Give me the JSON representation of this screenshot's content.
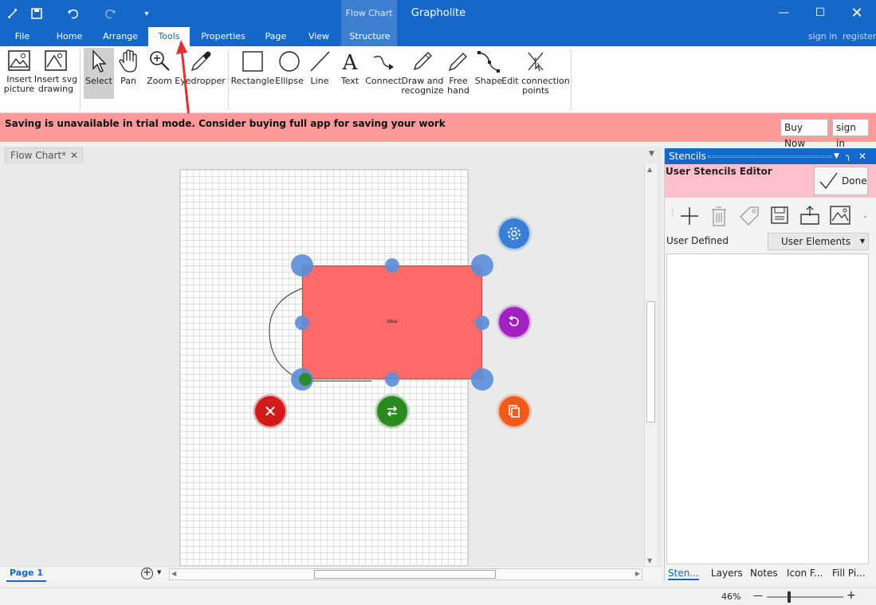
{
  "app": {
    "title": "Grapholite",
    "context_group": "Flow Chart"
  },
  "menu": {
    "tabs": [
      {
        "label": "File"
      },
      {
        "label": "Home"
      },
      {
        "label": "Arrange"
      },
      {
        "label": "Tools"
      },
      {
        "label": "Properties"
      },
      {
        "label": "Page"
      },
      {
        "label": "View"
      },
      {
        "label": "Structure"
      }
    ],
    "active": "Tools",
    "sign_in": "sign in",
    "register": "register"
  },
  "ribbon": {
    "insert_picture": "Insert\npicture",
    "insert_svg": "Insert svg\ndrawing",
    "select": "Select",
    "pan": "Pan",
    "zoom": "Zoom",
    "eyedropper": "Eyedropper",
    "rectangle": "Rectangle",
    "ellipse": "Ellipse",
    "line": "Line",
    "text": "Text",
    "connect": "Connect",
    "draw_recognize": "Draw and\nrecognize",
    "free_hand": "Free\nhand",
    "shape": "Shape",
    "edit_points": "Edit connection\npoints"
  },
  "banner": {
    "message": "Saving is unavailable in trial mode. Consider buying full app for saving your work",
    "buy_now": "Buy Now",
    "sign_in": "sign in"
  },
  "document": {
    "tab_label": "Flow Chart*",
    "shape_text": "Idea",
    "page_tab": "Page 1"
  },
  "stencils": {
    "title": "Stencils",
    "editor_title": "User Stencils Editor",
    "done": "Done",
    "category_label": "User Defined",
    "dropdown_value": "User Elements",
    "bottom_tabs": [
      "Sten...",
      "Layers",
      "Notes",
      "Icon F...",
      "Fill Pi..."
    ]
  },
  "status": {
    "zoom": "46%"
  },
  "colors": {
    "accent": "#1567c8",
    "banner": "#ff9a9a",
    "shape_fill": "#ff6b6b",
    "panel_header": "#ffc0cb"
  }
}
